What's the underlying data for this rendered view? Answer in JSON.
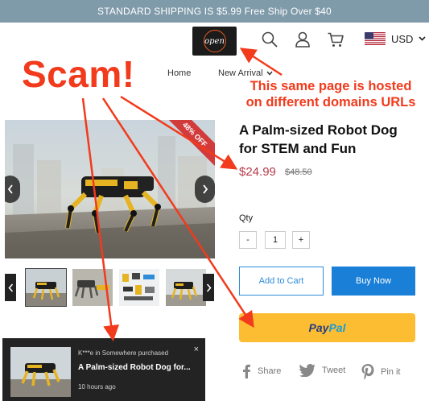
{
  "announcement": {
    "text": "STANDARD SHIPPING IS $5.99 Free Ship Over $40"
  },
  "header": {
    "logo_text": "open",
    "currency": "USD",
    "nav": [
      {
        "label": "Home"
      },
      {
        "label": "New Arrival"
      }
    ]
  },
  "annotations": {
    "scam": "Scam!",
    "note_line1": "This same page is hosted",
    "note_line2": "on different domains URLs",
    "color": "#f23a1c"
  },
  "gallery": {
    "badge": "48% OFF",
    "thumbnail_count": 5,
    "badge_color": "#d23b3b"
  },
  "product": {
    "title_line1": "A Palm-sized Robot Dog",
    "title_line2": "for STEM and Fun",
    "price": "$24.99",
    "compare_price": "$48.50",
    "qty_label": "Qty",
    "qty_minus": "-",
    "qty_value": "1",
    "qty_plus": "+",
    "add_to_cart": "Add to Cart",
    "buy_now": "Buy Now",
    "paypal_part1": "Pay",
    "paypal_part2": "Pal",
    "price_color": "#b8394a",
    "accent_color": "#1a7fd6"
  },
  "share": [
    {
      "icon": "facebook-icon",
      "label": "Share"
    },
    {
      "icon": "twitter-icon",
      "label": "Tweet"
    },
    {
      "icon": "pinterest-icon",
      "label": "Pin it"
    }
  ],
  "popup": {
    "line1": "K***e in Somewhere purchased",
    "line2": "A Palm-sized Robot Dog for...",
    "line3": "10 hours ago",
    "close": "×"
  }
}
